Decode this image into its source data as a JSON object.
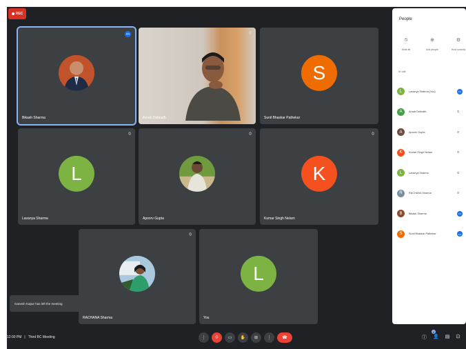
{
  "recording": {
    "label": "REC"
  },
  "tiles": [
    {
      "name": "Bikash Sharma",
      "kind": "photo",
      "status": "speaking"
    },
    {
      "name": "Arnab Debnath",
      "kind": "video",
      "status": "muted"
    },
    {
      "name": "Sunil Bhaskar Pathekar",
      "kind": "letter",
      "letter": "S",
      "color": "#ef6c00"
    },
    {
      "name": "Lavanya Sharma",
      "kind": "letter",
      "letter": "L",
      "color": "#7cb342",
      "status": "muted"
    },
    {
      "name": "Apoorv Gupta",
      "kind": "photo",
      "status": "muted"
    },
    {
      "name": "Kumar Singh Nelam",
      "kind": "letter",
      "letter": "K",
      "color": "#f4511e",
      "status": "muted"
    },
    {
      "name": "RACHANA Sharma",
      "kind": "photo",
      "status": "muted"
    },
    {
      "name": "You",
      "kind": "letter",
      "letter": "L",
      "color": "#7cb342"
    }
  ],
  "toast": {
    "text": "Ganesh Kapur has left the meeting"
  },
  "meeting": {
    "time": "12:00 PM",
    "separator": "|",
    "title": "Third BC Meeting"
  },
  "controls": [
    "more-options-icon",
    "mic-off-icon",
    "camera-icon",
    "raise-hand-icon",
    "present-icon",
    "more-vert-icon",
    "end-call-icon"
  ],
  "people_badge": "8",
  "panel": {
    "title": "People",
    "actions": [
      {
        "label": "Mute all",
        "icon": "mute-all-icon"
      },
      {
        "label": "Add people",
        "icon": "add-people-icon"
      },
      {
        "label": "Host controls",
        "icon": "host-controls-icon"
      }
    ],
    "section": "In call",
    "people": [
      {
        "name": "Lavanya Sharma (You)",
        "letter": "L",
        "color": "#7cb342",
        "status": "speaking"
      },
      {
        "name": "Arnab Debnath",
        "letter": "A",
        "color": "#43a047",
        "status": "muted"
      },
      {
        "name": "Apoorv Gupta",
        "letter": "A",
        "color": "#6d4c41",
        "status": "muted"
      },
      {
        "name": "Kumar Singh Nelam",
        "letter": "K",
        "color": "#f4511e",
        "status": "muted"
      },
      {
        "name": "Lavanya Sharma",
        "letter": "L",
        "color": "#7cb342",
        "status": "muted"
      },
      {
        "name": "RACHANA Sharma",
        "letter": "R",
        "color": "#78909c",
        "status": "muted"
      },
      {
        "name": "Bikash Sharma",
        "letter": "B",
        "color": "#8d4a2a",
        "status": "speaking"
      },
      {
        "name": "Sunil Bhaskar Pathekar",
        "letter": "S",
        "color": "#ef6c00",
        "status": "speaking"
      }
    ]
  }
}
